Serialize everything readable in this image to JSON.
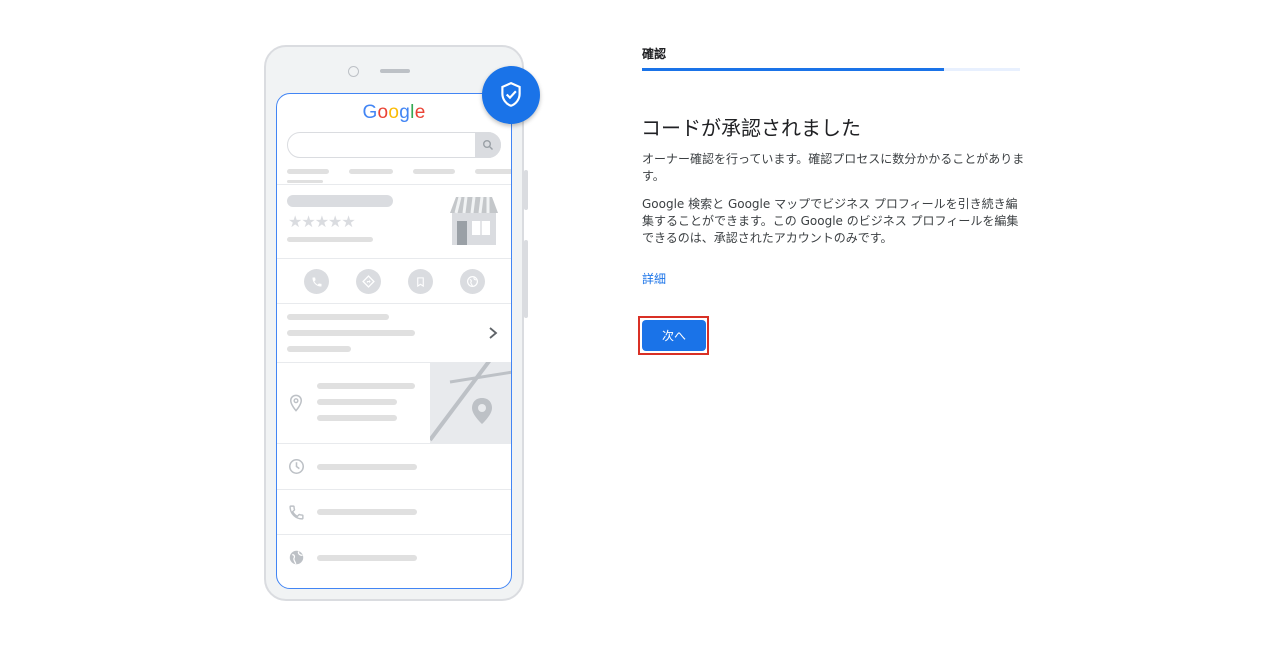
{
  "illustration": {
    "logo_letters": [
      {
        "ch": "G",
        "color": "#4285f4"
      },
      {
        "ch": "o",
        "color": "#ea4335"
      },
      {
        "ch": "o",
        "color": "#fbbc05"
      },
      {
        "ch": "g",
        "color": "#4285f4"
      },
      {
        "ch": "l",
        "color": "#34a853"
      },
      {
        "ch": "e",
        "color": "#ea4335"
      }
    ],
    "stars": "★★★★★",
    "badge_icon": "verified-shield-icon"
  },
  "progress": {
    "step_label": "確認",
    "fraction": 0.8
  },
  "content": {
    "heading": "コードが承認されました",
    "paragraph1": "オーナー確認を行っています。確認プロセスに数分かかることがあります。",
    "paragraph2": "Google 検索と Google マップでビジネス プロフィールを引き続き編集することができます。この Google のビジネス プロフィールを編集できるのは、承認されたアカウントのみです。",
    "details_link": "詳細",
    "next_button": "次へ"
  },
  "colors": {
    "accent": "#1a73e8",
    "highlight_outline": "#d93025"
  }
}
